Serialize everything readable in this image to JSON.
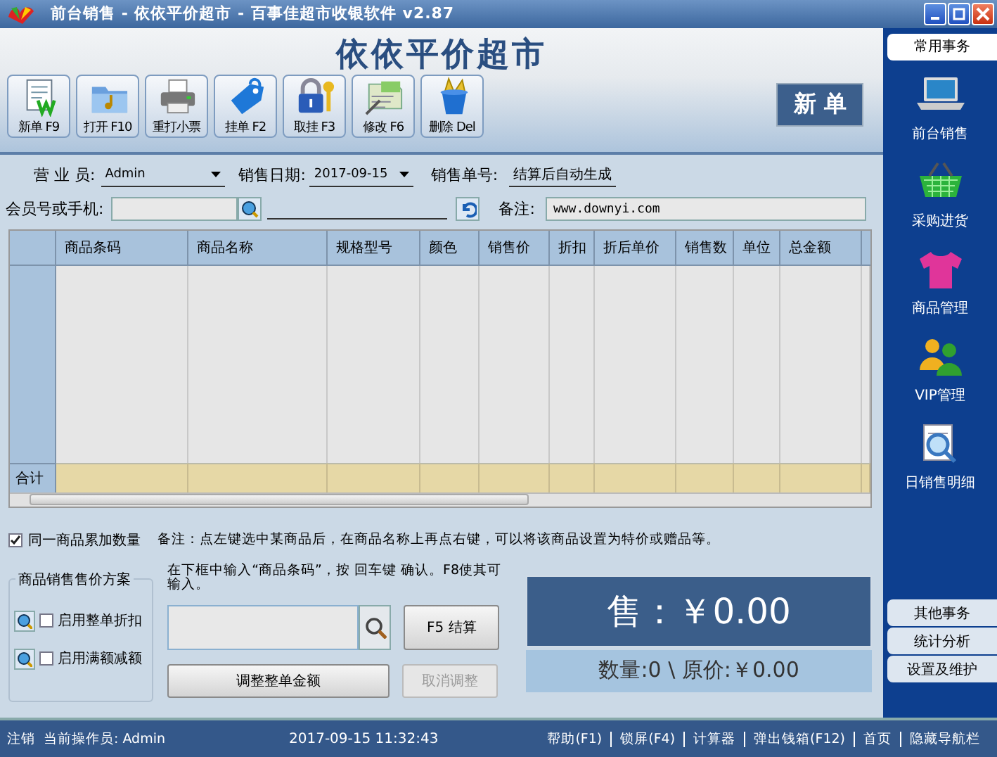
{
  "window": {
    "title": "前台销售 - 依依平价超市 - 百事佳超市收银软件 v2.87"
  },
  "header": {
    "title": "依依平价超市",
    "badge": "新 单"
  },
  "toolbar": [
    {
      "label": "新单 F9"
    },
    {
      "label": "打开 F10"
    },
    {
      "label": "重打小票"
    },
    {
      "label": "挂单 F2"
    },
    {
      "label": "取挂 F3"
    },
    {
      "label": "修改 F6"
    },
    {
      "label": "删除 Del"
    }
  ],
  "form": {
    "salesperson": {
      "label": "营 业 员:",
      "value": "Admin"
    },
    "sale_date": {
      "label": "销售日期:",
      "value": "2017-09-15"
    },
    "sale_number": {
      "label": "销售单号:",
      "value": "结算后自动生成"
    },
    "member": {
      "label": "会员号或手机:"
    },
    "remark": {
      "label": "备注:",
      "value": "www.downyi.com"
    }
  },
  "table": {
    "columns": [
      "商品条码",
      "商品名称",
      "规格型号",
      "颜色",
      "销售价",
      "折扣",
      "折后单价",
      "销售数",
      "单位",
      "总金额"
    ],
    "total_label": "合计"
  },
  "accumulate": {
    "label": "同一商品累加数量",
    "checked": true
  },
  "note": "备注：点左键选中某商品后，在商品名称上再点右键，可以将该商品设置为特价或赠品等。",
  "pricing": {
    "title": "商品销售售价方案",
    "options": [
      {
        "label": "启用整单折扣",
        "checked": false
      },
      {
        "label": "启用满额减额",
        "checked": false
      }
    ]
  },
  "entry": {
    "instruction": "在下框中输入“商品条码”，按 回车键 确认。F8使其可输入。",
    "checkout_button": "F5 结算",
    "adjust_button": {
      "label": "调整整单金额",
      "disabled": false
    },
    "cancel_button": {
      "label": "取消调整",
      "disabled": true
    }
  },
  "display": {
    "sale": "售：￥0.00",
    "summary": "数量:0 \\ 原价:￥0.00"
  },
  "sidebar": {
    "sections": [
      {
        "label": "常用事务",
        "selected": true
      },
      {
        "label": "其他事务",
        "selected": false
      },
      {
        "label": "统计分析",
        "selected": false
      },
      {
        "label": "设置及维护",
        "selected": false
      }
    ],
    "items": [
      {
        "label": "前台销售"
      },
      {
        "label": "采购进货"
      },
      {
        "label": "商品管理"
      },
      {
        "label": "VIP管理"
      },
      {
        "label": "日销售明细"
      }
    ]
  },
  "status_bar": {
    "logout": "注销",
    "operator": "当前操作员: Admin",
    "datetime": "2017-09-15 11:32:43",
    "links": [
      "帮助(F1)",
      "锁屏(F4)",
      "计算器",
      "弹出钱箱(F12)",
      "首页",
      "隐藏导航栏"
    ]
  }
}
